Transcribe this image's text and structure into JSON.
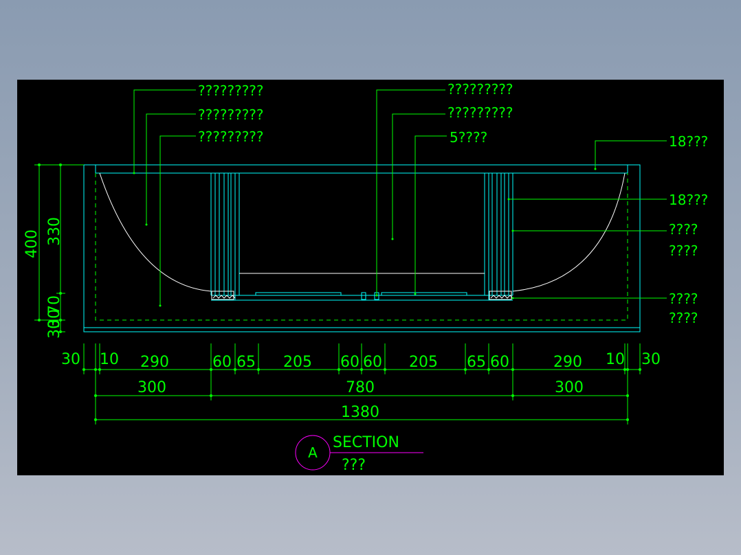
{
  "colors": {
    "background_outer": "#8c9cb0",
    "canvas": "#000000",
    "dimension": "#00ff00",
    "geometry": "#00ffff",
    "curve": "#ffffff",
    "title_mark": "#ff00ff"
  },
  "labels_left": [
    "?????????",
    "?????????",
    "?????????"
  ],
  "labels_center": [
    "?????????",
    "?????????",
    "5????"
  ],
  "labels_right": {
    "top": "18???",
    "second": "18???",
    "third_line1": "????",
    "third_line2": "????",
    "fourth_line1": "????",
    "fourth_line2": "????"
  },
  "dims_vertical": {
    "outer": "400",
    "inner": "330",
    "lower": "70",
    "bottom_a": "30",
    "bottom_b": "30"
  },
  "dims_row1": [
    "30",
    "10",
    "290",
    "60",
    "65",
    "205",
    "60",
    "60",
    "205",
    "65",
    "60",
    "290",
    "10",
    "30"
  ],
  "dims_row2": [
    "300",
    "780",
    "300"
  ],
  "dims_row3": [
    "1380"
  ],
  "section_marker": {
    "letter": "A",
    "title": "SECTION",
    "subtitle": "???"
  }
}
